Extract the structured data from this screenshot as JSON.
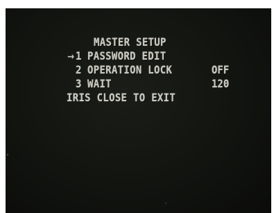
{
  "menu": {
    "title": "MASTER SETUP",
    "cursor_symbol": "→",
    "items": [
      {
        "number": "1",
        "label": "PASSWORD EDIT",
        "value": ""
      },
      {
        "number": "2",
        "label": "OPERATION LOCK",
        "value": "OFF"
      },
      {
        "number": "3",
        "label": "WAIT",
        "value": "120"
      }
    ],
    "selected_index": 0,
    "exit_hint": "IRIS CLOSE TO EXIT"
  },
  "colors": {
    "screen_background": "#131510",
    "text": "#c9c9c0"
  }
}
